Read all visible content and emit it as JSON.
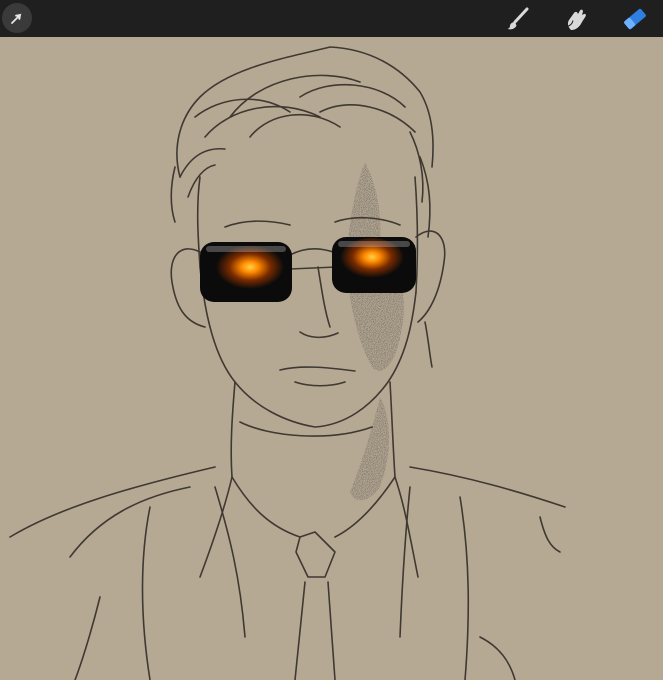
{
  "app": {
    "theme": {
      "toolbar_bg": "#1f1f1f",
      "canvas_bg": "#b6a994",
      "active_tool_color": "#2f7fe0",
      "inactive_tool_color": "#d9d9d9"
    }
  },
  "toolbar": {
    "left": [
      {
        "name": "actions",
        "icon": "arrow-cursor-icon",
        "active": false
      }
    ],
    "right": [
      {
        "name": "brush",
        "icon": "paintbrush-icon",
        "active": false
      },
      {
        "name": "smudge",
        "icon": "finger-smudge-icon",
        "active": false
      },
      {
        "name": "eraser",
        "icon": "eraser-icon",
        "active": true
      }
    ]
  },
  "canvas": {
    "content": "sketch-portrait",
    "colors": {
      "line": "#3f3932",
      "lens": "#0b0b0b",
      "glow": "#ff8a00",
      "shadow_speckle": "#1a1714"
    }
  }
}
